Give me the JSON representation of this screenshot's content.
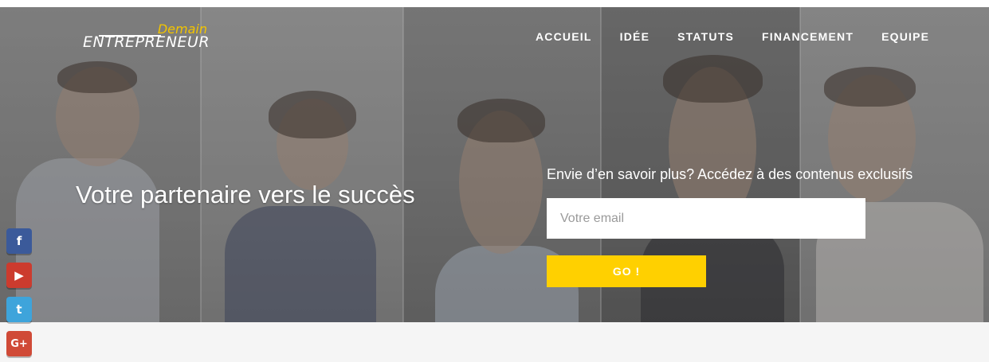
{
  "brand": {
    "logo_top": "Demain",
    "logo_main": "ENTREPRENEUR",
    "accent_color": "#ffd000"
  },
  "nav": {
    "items": [
      {
        "label": "ACCUEIL"
      },
      {
        "label": "IDÉE"
      },
      {
        "label": "STATUTS"
      },
      {
        "label": "FINANCEMENT"
      },
      {
        "label": "EQUIPE"
      }
    ]
  },
  "hero": {
    "headline": "Votre partenaire vers le succès",
    "cta_text": "Envie d’en savoir plus? Accédez à des contenus exclusifs",
    "email_placeholder": "Votre email",
    "go_label": "GO !"
  },
  "social": {
    "facebook_icon": "f",
    "youtube_icon": "▶",
    "twitter_icon": "t",
    "googleplus_icon": "G+"
  }
}
